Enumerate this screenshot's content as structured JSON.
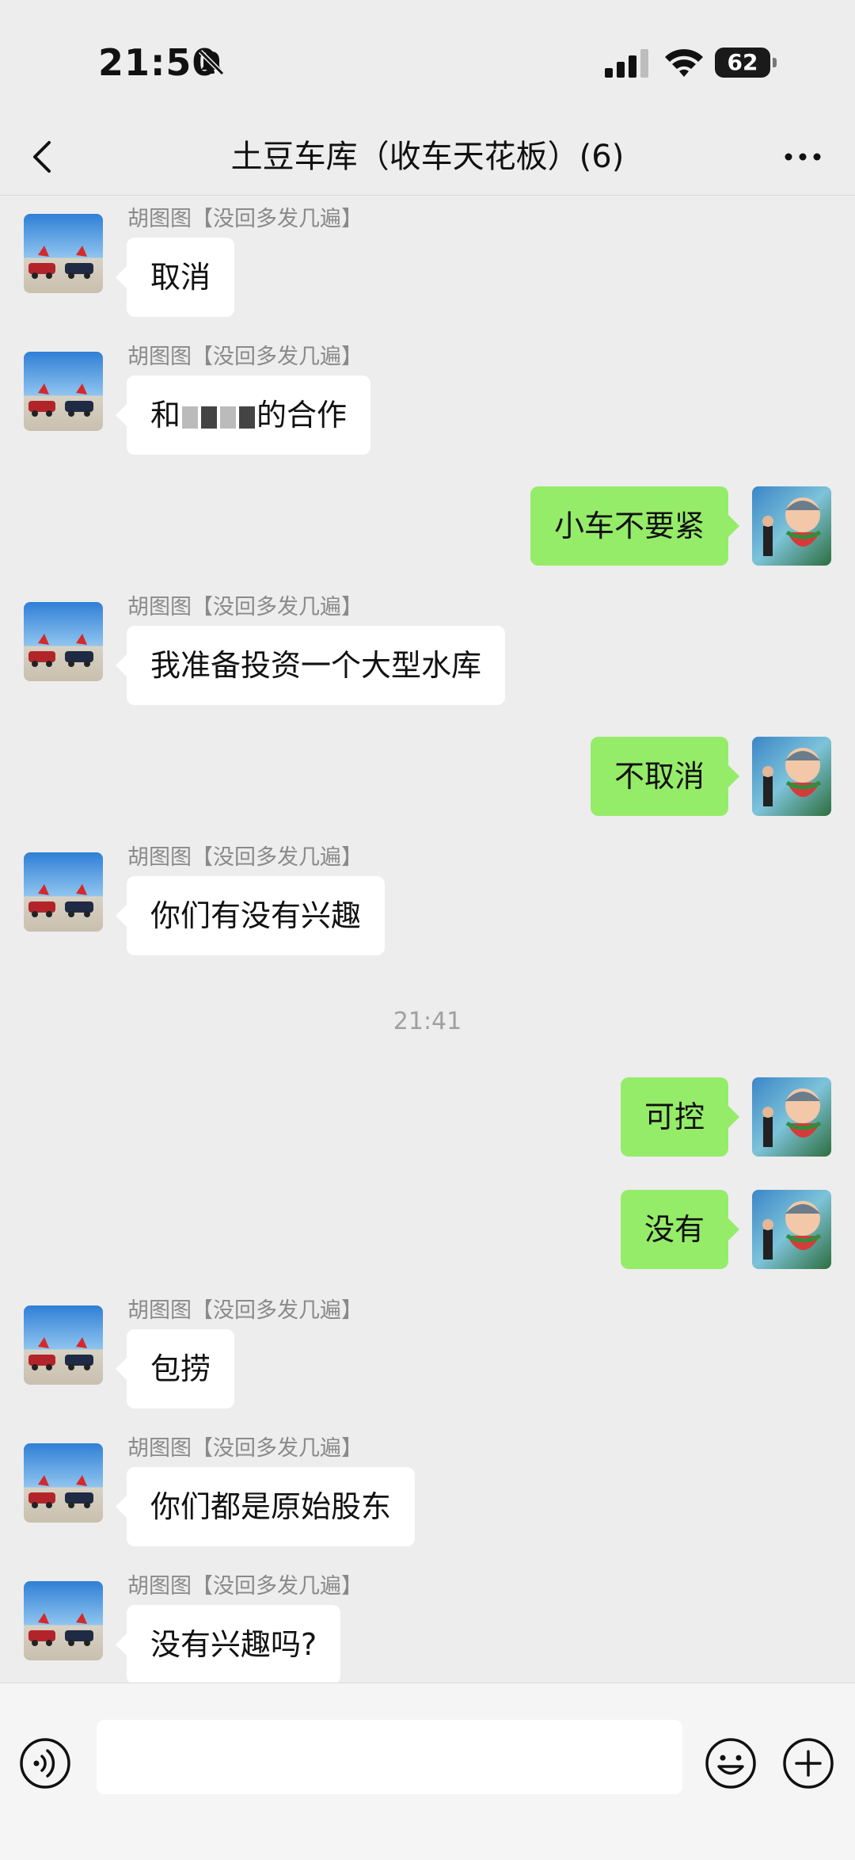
{
  "status_bar": {
    "time": "21:50",
    "battery": "62"
  },
  "nav": {
    "title": "土豆车库（收车天花板）(6)"
  },
  "sender_name": "胡图图【没回多发几遍】",
  "messages": {
    "m1": "取消",
    "m2_pre": "和",
    "m2_post": "的合作",
    "m3": "小车不要紧",
    "m4": "我准备投资一个大型水库",
    "m5": "不取消",
    "m6": "你们有没有兴趣",
    "ts1": "21:41",
    "m7": "可控",
    "m8": "没有",
    "m9": "包捞",
    "m10": "你们都是原始股东",
    "m11": "没有兴趣吗?"
  },
  "icons": {
    "back": "chevron-left-icon",
    "more": "more-dots-icon",
    "voice": "voice-icon",
    "emoji": "emoji-icon",
    "plus": "plus-icon"
  },
  "colors": {
    "outgoing_bubble": "#95ec69",
    "incoming_bubble": "#ffffff",
    "background": "#ededed"
  }
}
